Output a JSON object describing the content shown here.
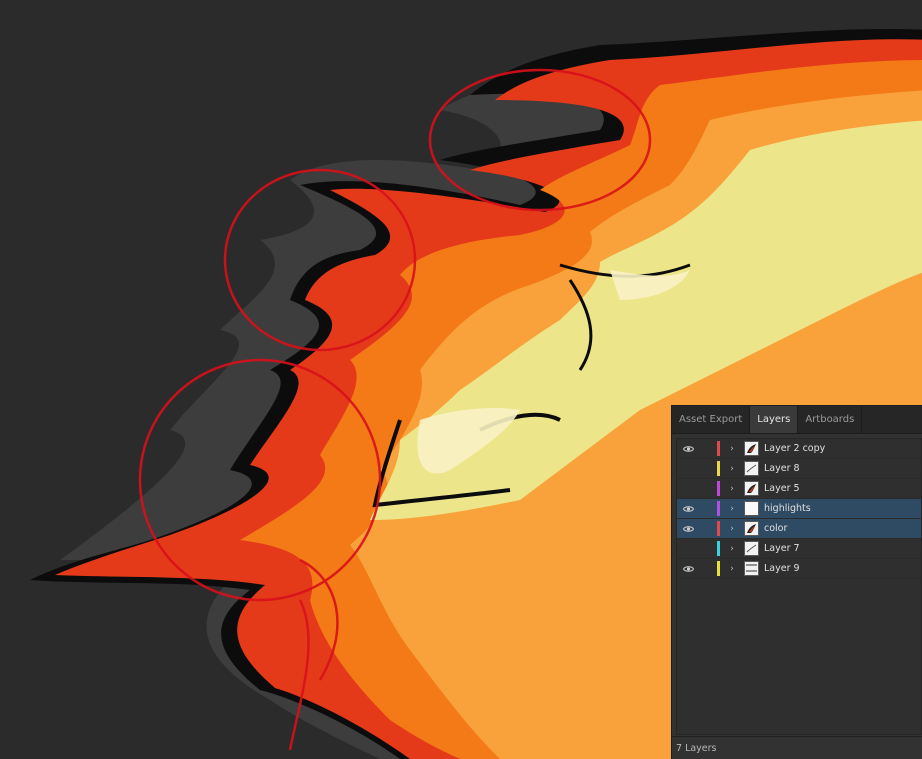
{
  "colors": {
    "canvas_bg": "#2b2b2b",
    "panel_bg": "#323232",
    "selected_row": "#2f4a63"
  },
  "layers_panel": {
    "tabs": [
      {
        "label": "Asset Export",
        "active": false
      },
      {
        "label": "Layers",
        "active": true
      },
      {
        "label": "Artboards",
        "active": false
      }
    ],
    "layers": [
      {
        "name": "Layer 2 copy",
        "color": "#e04a4a",
        "visible": true,
        "selected": false,
        "icon": "flame-thumbnail"
      },
      {
        "name": "Layer 8",
        "color": "#e8d84a",
        "visible": false,
        "selected": false,
        "icon": "sketch-thumbnail"
      },
      {
        "name": "Layer 5",
        "color": "#c048d8",
        "visible": false,
        "selected": false,
        "icon": "flame-thumbnail"
      },
      {
        "name": "highlights",
        "color": "#b050e0",
        "visible": true,
        "selected": true,
        "icon": "blank-thumbnail"
      },
      {
        "name": "color",
        "color": "#e04a4a",
        "visible": true,
        "selected": true,
        "icon": "flame-thumbnail"
      },
      {
        "name": "Layer 7",
        "color": "#3ad0e0",
        "visible": false,
        "selected": false,
        "icon": "sketch-thumbnail"
      },
      {
        "name": "Layer 9",
        "color": "#e8e040",
        "visible": true,
        "selected": false,
        "icon": "lines-thumbnail"
      }
    ],
    "footer": "7 Layers"
  }
}
